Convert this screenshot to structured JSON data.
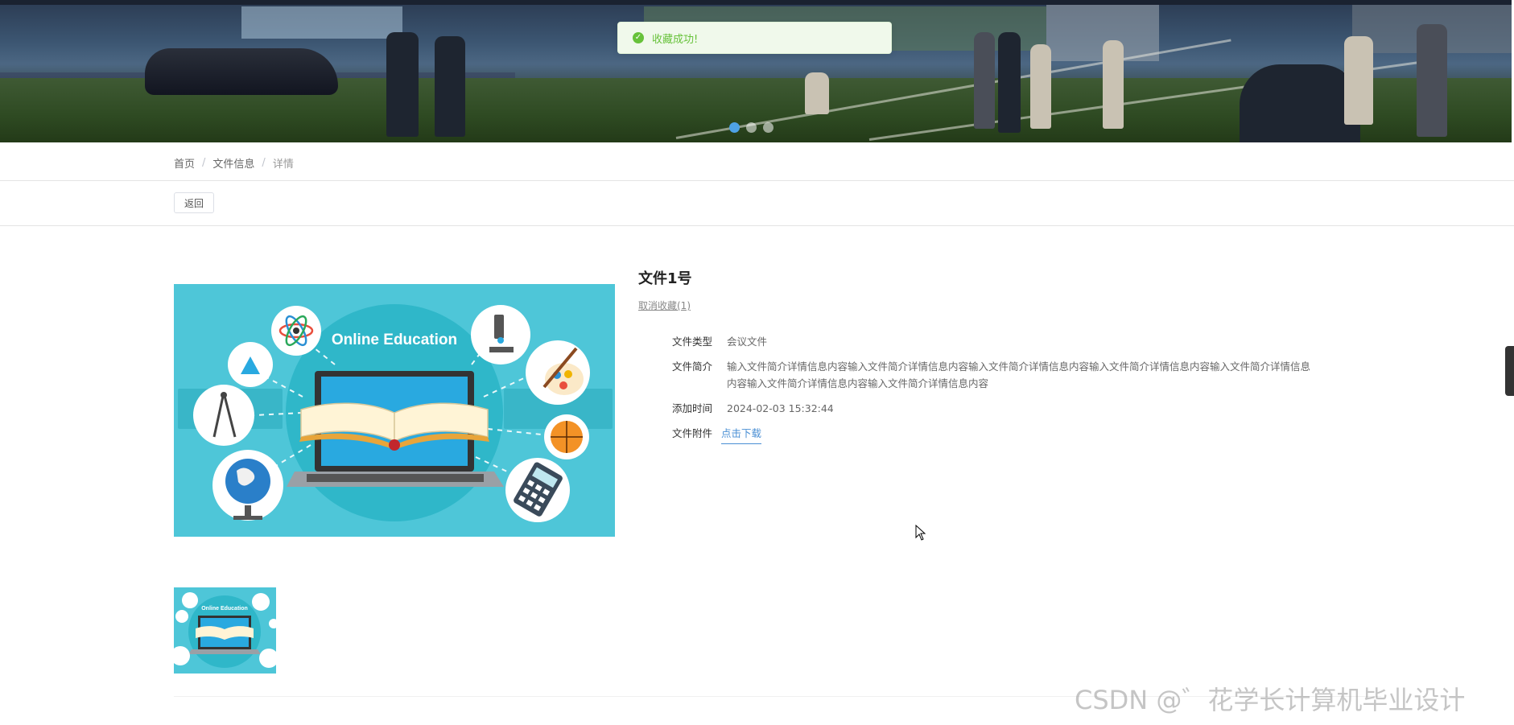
{
  "banner": {
    "carousel_active_index": 0,
    "carousel_count": 3
  },
  "toast": {
    "message": "收藏成功!",
    "icon": "check-circle-icon",
    "color": "#67c23a"
  },
  "breadcrumb": {
    "home": "首页",
    "section": "文件信息",
    "current": "详情",
    "separator": "/"
  },
  "toolbar": {
    "back_label": "返回"
  },
  "detail": {
    "title": "文件1号",
    "unfavorite_label": "取消收藏(1)",
    "fields": {
      "type_label": "文件类型",
      "type_value": "会议文件",
      "intro_label": "文件简介",
      "intro_value": "输入文件简介详情信息内容输入文件简介详情信息内容输入文件简介详情信息内容输入文件简介详情信息内容输入文件简介详情信息内容输入文件简介详情信息内容输入文件简介详情信息内容",
      "time_label": "添加时间",
      "time_value": "2024-02-03 15:32:44",
      "attachment_label": "文件附件",
      "attachment_link": "点击下载"
    },
    "image_caption": "Online Education",
    "thumb_caption": "Online Education"
  },
  "watermark": "CSDN @゛花学长计算机毕业设计",
  "colors": {
    "accent_link": "#4a8fd4",
    "success": "#67c23a",
    "image_bg": "#4ec6d8"
  }
}
